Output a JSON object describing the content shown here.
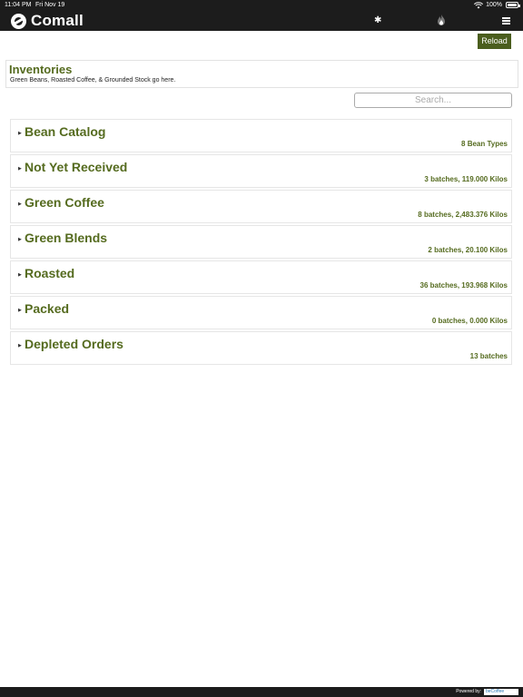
{
  "status_bar": {
    "time": "11:04 PM",
    "date": "Fri Nov 19",
    "battery": "100%"
  },
  "nav": {
    "app_name": "Comall"
  },
  "reload_label": "Reload",
  "inventories": {
    "title": "Inventories",
    "subtitle": "Green Beans, Roasted Coffee, & Grounded Stock go here."
  },
  "search": {
    "placeholder": "Search..."
  },
  "sections": [
    {
      "title": "Bean Catalog",
      "meta": "8 Bean Types"
    },
    {
      "title": "Not Yet Received",
      "meta": "3 batches, 119.000 Kilos"
    },
    {
      "title": "Green Coffee",
      "meta": "8 batches, 2,483.376 Kilos"
    },
    {
      "title": "Green Blends",
      "meta": "2 batches, 20.100 Kilos"
    },
    {
      "title": "Roasted",
      "meta": "36 batches, 193.968 Kilos"
    },
    {
      "title": "Packed",
      "meta": "0 batches, 0.000 Kilos"
    },
    {
      "title": "Depleted Orders",
      "meta": "13 batches"
    }
  ],
  "footer": {
    "powered_by": "Powered by:",
    "brand": "beCoffee"
  },
  "colors": {
    "accent": "#556b1f",
    "button": "#4b5e1e",
    "bar": "#1c1c1c"
  },
  "icons": {
    "nav": [
      "gear-icon",
      "flame-icon",
      "menu-icon"
    ],
    "section_toggle": "caret-right-icon"
  }
}
